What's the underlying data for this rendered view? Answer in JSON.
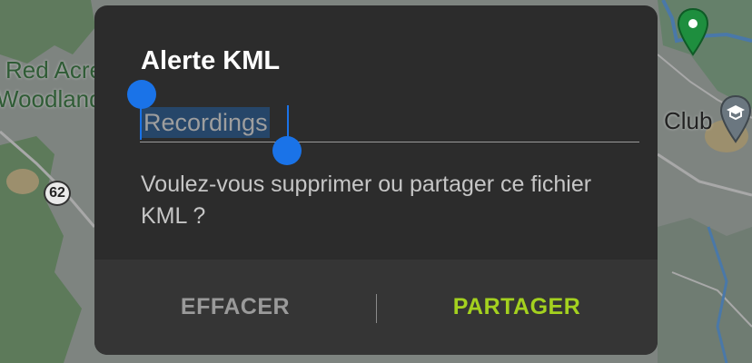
{
  "map": {
    "labels": {
      "area_line1": "Red Acre",
      "area_line2": "Woodland",
      "poi": "Club"
    },
    "route_number": "62",
    "icons": [
      "map-pin-icon",
      "school-pin-icon"
    ]
  },
  "dialog": {
    "title": "Alerte KML",
    "input_value": "Recordings",
    "message": "Voulez-vous supprimer ou partager ce fichier KML ?",
    "actions": {
      "clear": "EFFACER",
      "share": "PARTAGER"
    }
  },
  "colors": {
    "dialog_bg": "#2c2c2c",
    "actions_bg": "#353535",
    "accent": "#a4d11f",
    "selection": "#1a73e8"
  }
}
